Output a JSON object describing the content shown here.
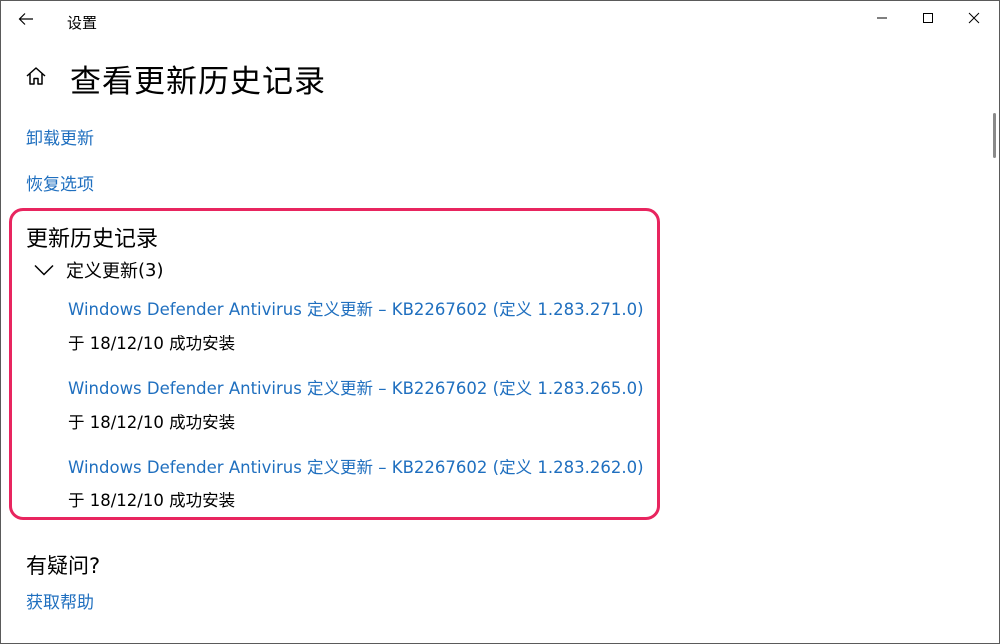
{
  "window": {
    "title": "设置"
  },
  "page": {
    "title": "查看更新历史记录"
  },
  "links": {
    "uninstall": "卸载更新",
    "recovery": "恢复选项"
  },
  "history": {
    "heading": "更新历史记录",
    "group": {
      "label": "定义更新",
      "count": "(3)"
    },
    "entries": [
      {
        "title": "Windows Defender Antivirus 定义更新 – KB2267602 (定义 1.283.271.0)",
        "status": "于 18/12/10 成功安装"
      },
      {
        "title": "Windows Defender Antivirus 定义更新 – KB2267602 (定义 1.283.265.0)",
        "status": "于 18/12/10 成功安装"
      },
      {
        "title": "Windows Defender Antivirus 定义更新 – KB2267602 (定义 1.283.262.0)",
        "status": "于 18/12/10 成功安装"
      }
    ]
  },
  "help": {
    "heading": "有疑问?",
    "link": "获取帮助"
  },
  "icons": {
    "back": "back-arrow-icon",
    "home": "home-icon",
    "minimize": "minimize-icon",
    "maximize": "maximize-icon",
    "close": "close-icon",
    "chevron": "chevron-down-icon"
  },
  "colors": {
    "link": "#1f6fbf",
    "highlight": "#e8255f"
  }
}
